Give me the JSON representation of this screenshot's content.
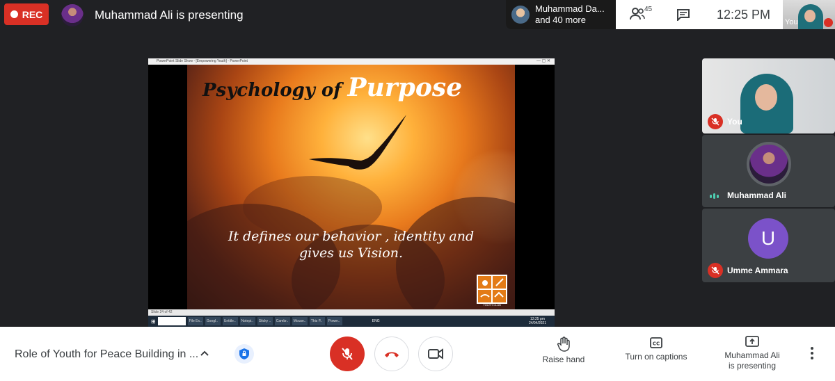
{
  "top": {
    "rec_label": "REC",
    "presenting_title": "Muhammad Ali is presenting",
    "participants_name": "Muhammad Da...",
    "participants_more": "and 40 more",
    "people_count": "45",
    "clock": "12:25 PM",
    "self_label": "You"
  },
  "presentation": {
    "window_title": "PowerPoint Slide Show - [Empowering Youth] - PowerPoint",
    "slide_title_small": "Psychology of",
    "slide_title_big": "Purpose",
    "slide_line1": "It defines our behavior , identity and",
    "slide_line2": "gives us Vision.",
    "logo_text": "YOUTH CLUB",
    "status_text": "Slide 24 of 42",
    "taskbar_items": [
      "File Ex..",
      "Googl..",
      "Untitle..",
      "Notepi..",
      "Sticky ..",
      "Cambr..",
      "Mouse..",
      "This P..",
      "Power.."
    ],
    "taskbar_lang": "ENG",
    "taskbar_time": "12:25 pm",
    "taskbar_date": "24/04/2021"
  },
  "tiles": [
    {
      "name": "You",
      "muted": true
    },
    {
      "name": "Muhammad Ali",
      "muted": false,
      "speaking": true
    },
    {
      "name": "Umme Ammara",
      "muted": true,
      "initial": "U"
    }
  ],
  "bottom": {
    "meeting_title": "Role of Youth for Peace Building in ...",
    "raise_hand": "Raise hand",
    "captions": "Turn on captions",
    "presenting_line1": "Muhammad Ali",
    "presenting_line2": "is presenting"
  },
  "colors": {
    "red": "#d93025",
    "avatar_purple": "#7b52c9",
    "tile_bg": "#3c4043",
    "background": "#202124"
  }
}
